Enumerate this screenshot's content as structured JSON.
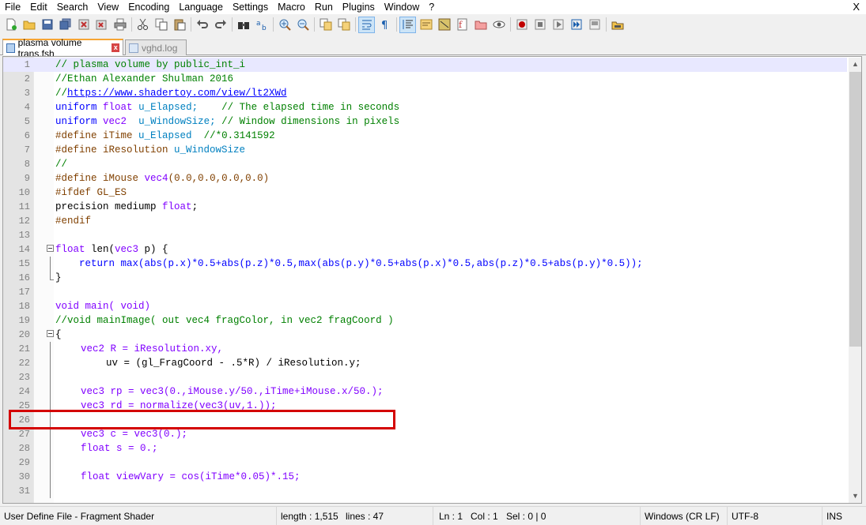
{
  "menu": [
    "File",
    "Edit",
    "Search",
    "View",
    "Encoding",
    "Language",
    "Settings",
    "Macro",
    "Run",
    "Plugins",
    "Window",
    "?"
  ],
  "window_close": "X",
  "tabs": [
    {
      "label": "plasma volume trans.fsh",
      "close": "x"
    },
    {
      "label": "vghd.log"
    }
  ],
  "editor": {
    "line_numbers": [
      "1",
      "2",
      "3",
      "4",
      "5",
      "6",
      "7",
      "8",
      "9",
      "10",
      "11",
      "12",
      "13",
      "14",
      "15",
      "16",
      "17",
      "18",
      "19",
      "20",
      "21",
      "22",
      "23",
      "24",
      "25",
      "26",
      "27",
      "28",
      "29",
      "30",
      "31"
    ],
    "lines": {
      "l1": "// plasma volume by public_int_i",
      "l2": "//Ethan Alexander Shulman 2016",
      "l3a": "//",
      "l3b": "https://www.shadertoy.com/view/lt2XWd",
      "l4a": "uniform",
      "l4b": "float",
      "l4c": "u_Elapsed;",
      "l4d": "// The elapsed time in seconds",
      "l5a": "uniform",
      "l5b": "vec2",
      "l5c": "u_WindowSize;",
      "l5d": "// Window dimensions in pixels",
      "l6a": "#define iTime",
      "l6b": "u_Elapsed",
      "l6c": "//*0.3141592",
      "l7a": "#define iResolution",
      "l7b": "u_WindowSize",
      "l8": "//",
      "l9a": "#define iMouse",
      "l9b": "vec4",
      "l9c": "(0.0,0.0,0.0,0.0)",
      "l10": "#ifdef GL_ES",
      "l11a": "precision mediump",
      "l11b": "float",
      "l11c": ";",
      "l12": "#endif",
      "l14a": "float",
      "l14b": " len(",
      "l14c": "vec3",
      "l14d": " p) {",
      "l15": "    return max(abs(p.x)*0.5+abs(p.z)*0.5,max(abs(p.y)*0.5+abs(p.x)*0.5,abs(p.z)*0.5+abs(p.y)*0.5));",
      "l16": "}",
      "l18": "void main( void)",
      "l19": "//void mainImage( out vec4 fragColor, in vec2 fragCoord )",
      "l20": "{",
      "l21": "vec2 R = iResolution.xy,",
      "l22": "uv = (gl_FragCoord - .5*R) / iResolution.y;",
      "l24": "vec3 rp = vec3(0.,iMouse.y/50.,iTime+iMouse.x/50.);",
      "l25": "vec3 rd = normalize(vec3(uv,1.));",
      "l27": "vec3 c = vec3(0.);",
      "l28": "float s = 0.;",
      "l30": "float viewVary = cos(iTime*0.05)*.15;",
      "l31": ""
    }
  },
  "status": {
    "file_type": "User Define File - Fragment Shader",
    "length": "length : 1,515",
    "lines": "lines : 47",
    "ln": "Ln : 1",
    "col": "Col : 1",
    "sel": "Sel : 0 | 0",
    "eol": "Windows (CR LF)",
    "encoding": "UTF-8",
    "mode": "INS"
  }
}
